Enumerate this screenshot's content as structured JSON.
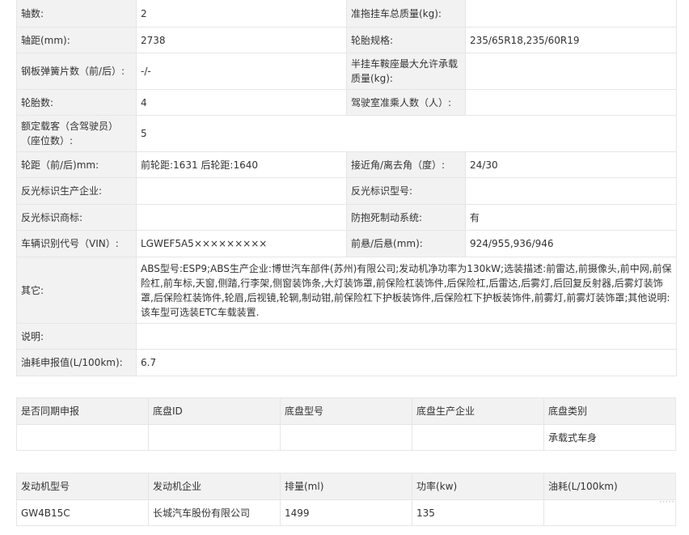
{
  "main": {
    "rows": [
      {
        "l1": "轴数:",
        "v1": "2",
        "l2": "准拖挂车总质量(kg):",
        "v2": ""
      },
      {
        "l1": "轴距(mm):",
        "v1": "2738",
        "l2": "轮胎规格:",
        "v2": "235/65R18,235/60R19"
      },
      {
        "l1": "钢板弹簧片数（前/后）:",
        "v1": "-/-",
        "l2": "半挂车鞍座最大允许承载质量(kg):",
        "v2": ""
      },
      {
        "l1": "轮胎数:",
        "v1": "4",
        "l2": "驾驶室准乘人数（人）:",
        "v2": ""
      },
      {
        "l1": "额定载客（含驾驶员）（座位数）:",
        "v1": "5"
      },
      {
        "l1": "轮距（前/后)mm:",
        "v1": "前轮距:1631 后轮距:1640",
        "l2": "接近角/离去角（度）:",
        "v2": "24/30"
      },
      {
        "l1": "反光标识生产企业:",
        "v1": "",
        "l2": "反光标识型号:",
        "v2": ""
      },
      {
        "l1": "反光标识商标:",
        "v1": "",
        "l2": "防抱死制动系统:",
        "v2": "有"
      },
      {
        "l1": "车辆识别代号（VIN）:",
        "v1": "LGWEF5A5×××××××××",
        "l2": "前悬/后悬(mm):",
        "v2": "924/955,936/946"
      },
      {
        "l1": "其它:",
        "v1": "ABS型号:ESP9;ABS生产企业:博世汽车部件(苏州)有限公司;发动机净功率为130kW;选装描述:前雷达,前摄像头,前中网,前保险杠,前车标,天窗,侧踏,行李架,侧窗装饰条,大灯装饰罩,前保险杠装饰件,后保险杠,后雷达,后雾灯,后回复反射器,后雾灯装饰罩,后保险杠装饰件,轮眉,后视镜,轮辋,制动钳,前保险杠下护板装饰件,后保险杠下护板装饰件,前雾灯,前雾灯装饰罩;其他说明:该车型可选装ETC车载装置."
      },
      {
        "l1": "说明:",
        "v1": ""
      },
      {
        "l1": "油耗申报值(L/100km):",
        "v1": "6.7"
      }
    ]
  },
  "chassis": {
    "headers": [
      "是否同期申报",
      "底盘ID",
      "底盘型号",
      "底盘生产企业",
      "底盘类别"
    ],
    "values": [
      "",
      "",
      "",
      "",
      "承载式车身"
    ]
  },
  "engine": {
    "headers": [
      "发动机型号",
      "发动机企业",
      "排量(ml)",
      "功率(kw)",
      "油耗(L/100km)"
    ],
    "values": [
      "GW4B15C",
      "长城汽车股份有限公司",
      "1499",
      "135",
      ""
    ]
  },
  "watermark": "·····"
}
